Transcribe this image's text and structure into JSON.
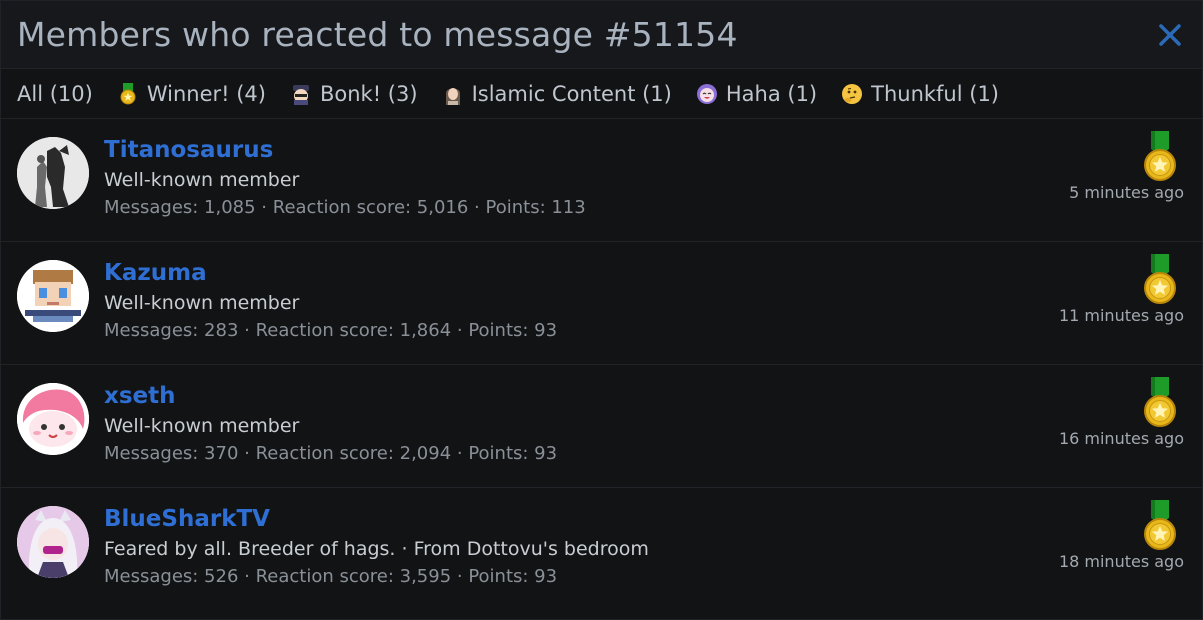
{
  "header": {
    "title": "Members who reacted to message #51154"
  },
  "tabs": [
    {
      "label": "All (10)",
      "icon": "none"
    },
    {
      "label": "Winner! (4)",
      "icon": "gold-medal-icon"
    },
    {
      "label": "Bonk! (3)",
      "icon": "bonk-icon"
    },
    {
      "label": "Islamic Content (1)",
      "icon": "islamic-content-icon"
    },
    {
      "label": "Haha (1)",
      "icon": "haha-icon"
    },
    {
      "label": "Thunkful (1)",
      "icon": "thinking-face-icon"
    }
  ],
  "members": [
    {
      "name": "Titanosaurus",
      "title": "Well-known member",
      "stats": "Messages: 1,085 · Reaction score: 5,016 · Points: 113",
      "time": "5 minutes ago",
      "reaction": "gold-medal-icon"
    },
    {
      "name": "Kazuma",
      "title": "Well-known member",
      "stats": "Messages: 283 · Reaction score: 1,864 · Points: 93",
      "time": "11 minutes ago",
      "reaction": "gold-medal-icon"
    },
    {
      "name": "xseth",
      "title": "Well-known member",
      "stats": "Messages: 370 · Reaction score: 2,094 · Points: 93",
      "time": "16 minutes ago",
      "reaction": "gold-medal-icon"
    },
    {
      "name": "BlueSharkTV",
      "title": "Feared by all. Breeder of hags. · From Dottovu's bedroom",
      "stats": "Messages: 526 · Reaction score: 3,595 · Points: 93",
      "time": "18 minutes ago",
      "reaction": "gold-medal-icon"
    }
  ],
  "colors": {
    "accent": "#2f6fd3",
    "background": "#121315",
    "close": "#2a6ab8"
  }
}
